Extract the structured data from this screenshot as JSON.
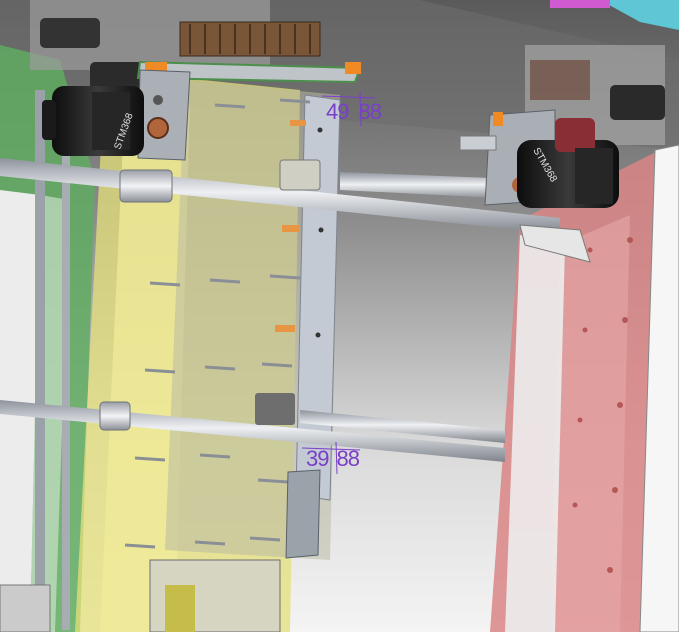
{
  "viewport": {
    "name": "cad-3d-assembly-view",
    "background_top": "#5d5d5d",
    "background_bottom": "#f3f3f3"
  },
  "colors": {
    "green_panel": "#5faa5f",
    "yellow_panel": "#e6e07a",
    "red_panel": "#d98585",
    "dimension": "#7a3fc9",
    "rod": "#c9ccd3",
    "motor": "#1c1c1c",
    "orange_clip": "#f08a24",
    "cyan_part": "#5fc6d6"
  },
  "dimensions": {
    "top": {
      "left": "49",
      "right": "88"
    },
    "bottom": {
      "left": "39",
      "right": "88"
    }
  },
  "motor_labels": {
    "left": "STM368",
    "right": "STM368"
  }
}
